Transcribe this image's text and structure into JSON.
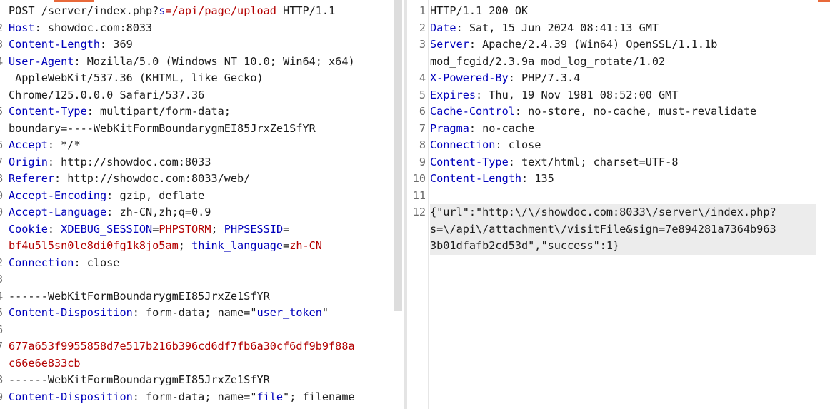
{
  "request": {
    "line_numbers": [
      "",
      "2",
      "3",
      "4",
      "",
      "",
      "5",
      "",
      "6",
      "7",
      "8",
      "9",
      "0",
      "",
      "",
      "2",
      "3",
      "4",
      "5",
      "6",
      "7",
      "",
      "8",
      "9"
    ],
    "lines": [
      [
        {
          "t": "POST /server/index.php?",
          "c": "plain"
        },
        {
          "t": "s",
          "c": "key"
        },
        {
          "t": "=/api/page/upload",
          "c": "sval"
        },
        {
          "t": " HTTP/1.1",
          "c": "plain"
        }
      ],
      [
        {
          "t": "Host",
          "c": "key"
        },
        {
          "t": ": showdoc.com:8033",
          "c": "plain"
        }
      ],
      [
        {
          "t": "Content-Length",
          "c": "key"
        },
        {
          "t": ": 369",
          "c": "plain"
        }
      ],
      [
        {
          "t": "User-Agent",
          "c": "key"
        },
        {
          "t": ": Mozilla/5.0 (Windows NT 10.0; Win64; x64)",
          "c": "plain"
        }
      ],
      [
        {
          "t": " AppleWebKit/537.36 (KHTML, like Gecko)",
          "c": "plain"
        }
      ],
      [
        {
          "t": "Chrome/125.0.0.0 Safari/537.36",
          "c": "plain"
        }
      ],
      [
        {
          "t": "Content-Type",
          "c": "key"
        },
        {
          "t": ": multipart/form-data;",
          "c": "plain"
        }
      ],
      [
        {
          "t": "boundary=----WebKitFormBoundarygmEI85JrxZe1SfYR",
          "c": "plain"
        }
      ],
      [
        {
          "t": "Accept",
          "c": "key"
        },
        {
          "t": ": */*",
          "c": "plain"
        }
      ],
      [
        {
          "t": "Origin",
          "c": "key"
        },
        {
          "t": ": http://showdoc.com:8033",
          "c": "plain"
        }
      ],
      [
        {
          "t": "Referer",
          "c": "key"
        },
        {
          "t": ": http://showdoc.com:8033/web/",
          "c": "plain"
        }
      ],
      [
        {
          "t": "Accept-Encoding",
          "c": "key"
        },
        {
          "t": ": gzip, deflate",
          "c": "plain"
        }
      ],
      [
        {
          "t": "Accept-Language",
          "c": "key"
        },
        {
          "t": ": zh-CN,zh;q=0.9",
          "c": "plain"
        }
      ],
      [
        {
          "t": "Cookie",
          "c": "key"
        },
        {
          "t": ": ",
          "c": "plain"
        },
        {
          "t": "XDEBUG_SESSION",
          "c": "key"
        },
        {
          "t": "=",
          "c": "plain"
        },
        {
          "t": "PHPSTORM",
          "c": "sval"
        },
        {
          "t": "; ",
          "c": "plain"
        },
        {
          "t": "PHPSESSID",
          "c": "key"
        },
        {
          "t": "=",
          "c": "plain"
        }
      ],
      [
        {
          "t": "bf4u5l5sn0le8di0fg1k8jo5am",
          "c": "sval"
        },
        {
          "t": "; ",
          "c": "plain"
        },
        {
          "t": "think_language",
          "c": "key"
        },
        {
          "t": "=",
          "c": "plain"
        },
        {
          "t": "zh-CN",
          "c": "sval"
        }
      ],
      [
        {
          "t": "Connection",
          "c": "key"
        },
        {
          "t": ": close",
          "c": "plain"
        }
      ],
      [],
      [
        {
          "t": "------WebKitFormBoundarygmEI85JrxZe1SfYR",
          "c": "plain"
        }
      ],
      [
        {
          "t": "Content-Disposition",
          "c": "key"
        },
        {
          "t": ": form-data; name=\"",
          "c": "plain"
        },
        {
          "t": "user_token",
          "c": "key"
        },
        {
          "t": "\"",
          "c": "plain"
        }
      ],
      [],
      [
        {
          "t": "677a653f9955858d7e517b216b396cd6df7fb6a30cf6df9b9f88a",
          "c": "sval"
        }
      ],
      [
        {
          "t": "c66e6e833cb",
          "c": "sval"
        }
      ],
      [
        {
          "t": "------WebKitFormBoundarygmEI85JrxZe1SfYR",
          "c": "plain"
        }
      ],
      [
        {
          "t": "Content-Disposition",
          "c": "key"
        },
        {
          "t": ": form-data; name=\"",
          "c": "plain"
        },
        {
          "t": "file",
          "c": "key"
        },
        {
          "t": "\"; filename",
          "c": "plain"
        }
      ]
    ]
  },
  "response": {
    "line_numbers": [
      "1",
      "2",
      "3",
      "",
      "4",
      "5",
      "6",
      "7",
      "8",
      "9",
      "10",
      "11",
      "12",
      "",
      ""
    ],
    "highlight_from": 12,
    "lines": [
      [
        {
          "t": "HTTP/1.1 200 OK",
          "c": "plain"
        }
      ],
      [
        {
          "t": "Date",
          "c": "key"
        },
        {
          "t": ": Sat, 15 Jun 2024 08:41:13 GMT",
          "c": "plain"
        }
      ],
      [
        {
          "t": "Server",
          "c": "key"
        },
        {
          "t": ": Apache/2.4.39 (Win64) OpenSSL/1.1.1b",
          "c": "plain"
        }
      ],
      [
        {
          "t": "mod_fcgid/2.3.9a mod_log_rotate/1.02",
          "c": "plain"
        }
      ],
      [
        {
          "t": "X-Powered-By",
          "c": "key"
        },
        {
          "t": ": PHP/7.3.4",
          "c": "plain"
        }
      ],
      [
        {
          "t": "Expires",
          "c": "key"
        },
        {
          "t": ": Thu, 19 Nov 1981 08:52:00 GMT",
          "c": "plain"
        }
      ],
      [
        {
          "t": "Cache-Control",
          "c": "key"
        },
        {
          "t": ": no-store, no-cache, must-revalidate",
          "c": "plain"
        }
      ],
      [
        {
          "t": "Pragma",
          "c": "key"
        },
        {
          "t": ": no-cache",
          "c": "plain"
        }
      ],
      [
        {
          "t": "Connection",
          "c": "key"
        },
        {
          "t": ": close",
          "c": "plain"
        }
      ],
      [
        {
          "t": "Content-Type",
          "c": "key"
        },
        {
          "t": ": text/html; charset=UTF-8",
          "c": "plain"
        }
      ],
      [
        {
          "t": "Content-Length",
          "c": "key"
        },
        {
          "t": ": 135",
          "c": "plain"
        }
      ],
      [],
      [
        {
          "t": "{\"url\":\"http:\\/\\/showdoc.com:8033\\/server\\/index.php?",
          "c": "plain"
        }
      ],
      [
        {
          "t": "s=\\/api\\/attachment\\/visitFile&sign=7e894281a7364b963",
          "c": "plain"
        }
      ],
      [
        {
          "t": "3b01dfafb2cd53d\",\"success\":1}",
          "c": "plain"
        }
      ]
    ]
  }
}
